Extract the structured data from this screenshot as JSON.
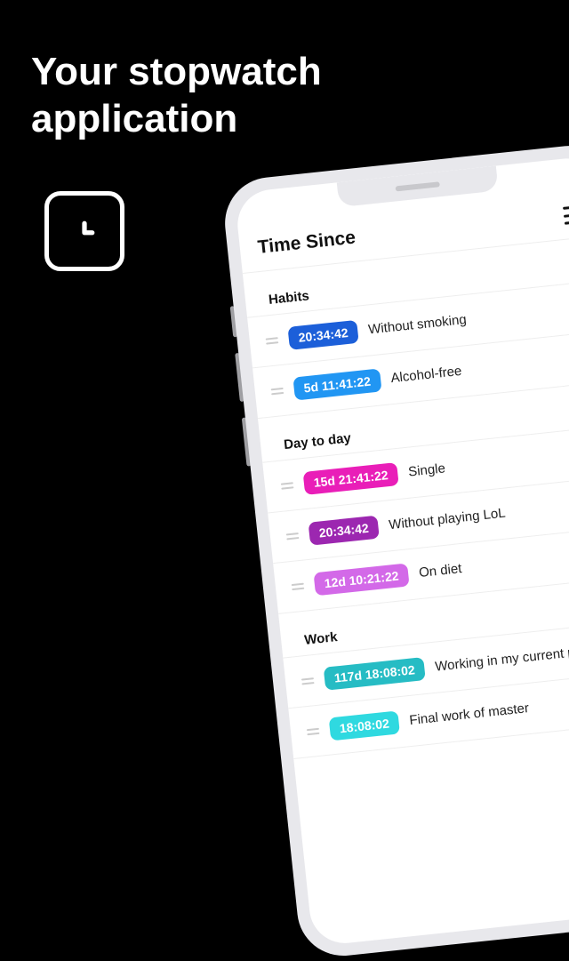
{
  "promo": {
    "title_line1": "Your stopwatch",
    "title_line2": "application"
  },
  "header": {
    "title": "Time Since"
  },
  "colors": {
    "blue1": "#1c5fd9",
    "blue2": "#2196f3",
    "magenta": "#e91eb8",
    "purple": "#9c27b0",
    "pink": "#d369e8",
    "teal1": "#26bcc4",
    "teal2": "#2fd9e0"
  },
  "sections": [
    {
      "title": "Habits",
      "items": [
        {
          "time": "20:34:42",
          "label": "Without smoking",
          "colorKey": "blue1"
        },
        {
          "time": "5d 11:41:22",
          "label": "Alcohol-free",
          "colorKey": "blue2"
        }
      ]
    },
    {
      "title": "Day to day",
      "items": [
        {
          "time": "15d 21:41:22",
          "label": "Single",
          "colorKey": "magenta"
        },
        {
          "time": "20:34:42",
          "label": "Without playing LoL",
          "colorKey": "purple"
        },
        {
          "time": "12d 10:21:22",
          "label": "On diet",
          "colorKey": "pink"
        }
      ]
    },
    {
      "title": "Work",
      "items": [
        {
          "time": "117d 18:08:02",
          "label": "Working in my current position",
          "colorKey": "teal1"
        },
        {
          "time": "18:08:02",
          "label": "Final work of master",
          "colorKey": "teal2"
        }
      ]
    }
  ]
}
